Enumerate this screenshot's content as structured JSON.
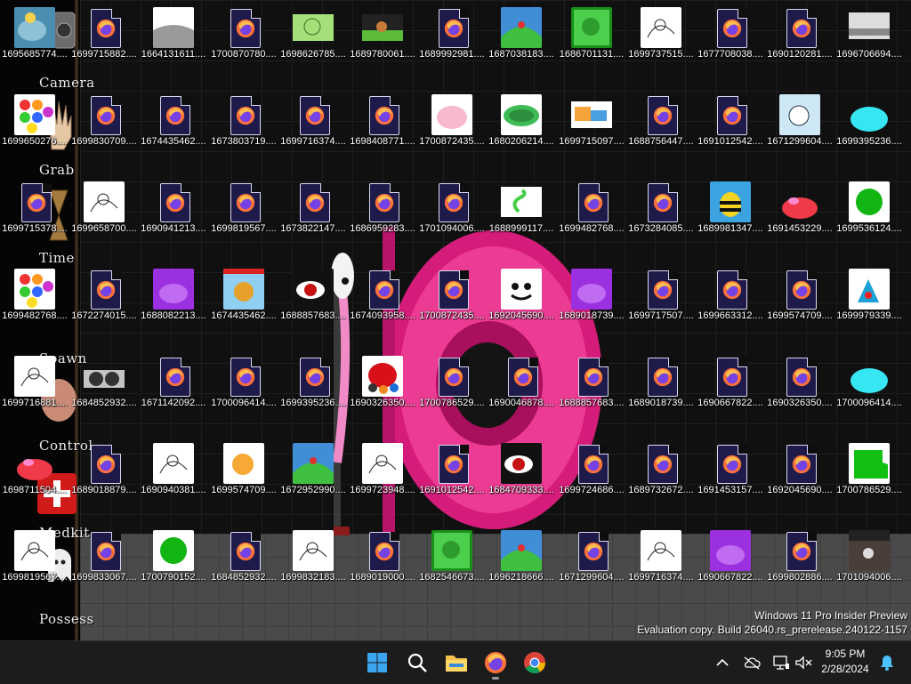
{
  "wallpaper": {
    "labels": [
      "Camera",
      "Grab",
      "Time",
      "Spawn",
      "Control",
      "Medkit",
      "Possess"
    ]
  },
  "icons": [
    {
      "label": "1695685774....",
      "kind": "game"
    },
    {
      "label": "1699715882....",
      "kind": "firefox"
    },
    {
      "label": "1664131611....",
      "kind": "gray"
    },
    {
      "label": "1700870780....",
      "kind": "firefox"
    },
    {
      "label": "1698626785....",
      "kind": "green-face"
    },
    {
      "label": "1689780061....",
      "kind": "scene"
    },
    {
      "label": "1689992981....",
      "kind": "firefox"
    },
    {
      "label": "1687038183....",
      "kind": "hill"
    },
    {
      "label": "1686701131....",
      "kind": "frog"
    },
    {
      "label": "1699737515....",
      "kind": "sketch"
    },
    {
      "label": "1677708038....",
      "kind": "firefox"
    },
    {
      "label": "1690120281....",
      "kind": "firefox"
    },
    {
      "label": "1696706694....",
      "kind": "road"
    },
    {
      "label": "1699650276....",
      "kind": "dots"
    },
    {
      "label": "1699830709....",
      "kind": "firefox"
    },
    {
      "label": "1674435462....",
      "kind": "firefox"
    },
    {
      "label": "1673803719....",
      "kind": "firefox"
    },
    {
      "label": "1699716374....",
      "kind": "firefox"
    },
    {
      "label": "1698408771....",
      "kind": "firefox"
    },
    {
      "label": "1700872435....",
      "kind": "pink-blob"
    },
    {
      "label": "1680206214....",
      "kind": "caterpillar"
    },
    {
      "label": "1699715097....",
      "kind": "orange-blue"
    },
    {
      "label": "1688756447....",
      "kind": "firefox"
    },
    {
      "label": "1691012542....",
      "kind": "firefox"
    },
    {
      "label": "1671299604....",
      "kind": "cat"
    },
    {
      "label": "1699395236....",
      "kind": "cyan-blob"
    },
    {
      "label": "1699715378....",
      "kind": "firefox"
    },
    {
      "label": "1699658700....",
      "kind": "sketch"
    },
    {
      "label": "1690941213....",
      "kind": "firefox"
    },
    {
      "label": "1699819567....",
      "kind": "firefox"
    },
    {
      "label": "1673822147....",
      "kind": "firefox"
    },
    {
      "label": "1686959283....",
      "kind": "firefox"
    },
    {
      "label": "1701094006....",
      "kind": "firefox"
    },
    {
      "label": "1688999117....",
      "kind": "snake"
    },
    {
      "label": "1699482768....",
      "kind": "firefox"
    },
    {
      "label": "1673284085....",
      "kind": "firefox"
    },
    {
      "label": "1689981347....",
      "kind": "bee"
    },
    {
      "label": "1691453229....",
      "kind": "red-blob"
    },
    {
      "label": "1699536124....",
      "kind": "green-circle"
    },
    {
      "label": "1699482768....",
      "kind": "dots"
    },
    {
      "label": "1672274015....",
      "kind": "firefox"
    },
    {
      "label": "1688082213....",
      "kind": "purple"
    },
    {
      "label": "1674435462....",
      "kind": "pineapple"
    },
    {
      "label": "1688857683....",
      "kind": "dark-red"
    },
    {
      "label": "1674093958....",
      "kind": "firefox"
    },
    {
      "label": "1700872435....",
      "kind": "firefox"
    },
    {
      "label": "1692045690....",
      "kind": "face"
    },
    {
      "label": "1689018739....",
      "kind": "purple"
    },
    {
      "label": "1699717507....",
      "kind": "firefox"
    },
    {
      "label": "1699663312....",
      "kind": "firefox"
    },
    {
      "label": "1699574709....",
      "kind": "firefox"
    },
    {
      "label": "1699979339....",
      "kind": "flag"
    },
    {
      "label": "1699716881....",
      "kind": "sketch"
    },
    {
      "label": "1684852932....",
      "kind": "dark-dots"
    },
    {
      "label": "1671142092....",
      "kind": "firefox"
    },
    {
      "label": "1700096414....",
      "kind": "firefox"
    },
    {
      "label": "1699395236....",
      "kind": "firefox"
    },
    {
      "label": "1690326350....",
      "kind": "red-bird"
    },
    {
      "label": "1700786529....",
      "kind": "firefox"
    },
    {
      "label": "1690046878....",
      "kind": "firefox"
    },
    {
      "label": "1688857683....",
      "kind": "firefox"
    },
    {
      "label": "1689018739....",
      "kind": "firefox"
    },
    {
      "label": "1690667822....",
      "kind": "firefox"
    },
    {
      "label": "1690326350....",
      "kind": "firefox"
    },
    {
      "label": "1700096414....",
      "kind": "cyan-blob"
    },
    {
      "label": "1698711504....",
      "kind": "red-blob"
    },
    {
      "label": "1689018879....",
      "kind": "firefox"
    },
    {
      "label": "1690940381....",
      "kind": "sketch"
    },
    {
      "label": "1699574709....",
      "kind": "orange-ball"
    },
    {
      "label": "1672952990....",
      "kind": "hill"
    },
    {
      "label": "1699723948....",
      "kind": "sketch"
    },
    {
      "label": "1691012542....",
      "kind": "firefox"
    },
    {
      "label": "1684709333....",
      "kind": "dark-red"
    },
    {
      "label": "1699724686....",
      "kind": "firefox"
    },
    {
      "label": "1689732672....",
      "kind": "firefox"
    },
    {
      "label": "1691453157....",
      "kind": "firefox"
    },
    {
      "label": "1692045690....",
      "kind": "firefox"
    },
    {
      "label": "1700786529....",
      "kind": "green-blob"
    },
    {
      "label": "1699819567....",
      "kind": "sketch"
    },
    {
      "label": "1699833067....",
      "kind": "firefox"
    },
    {
      "label": "1700790152....",
      "kind": "green-circle"
    },
    {
      "label": "1684852932....",
      "kind": "firefox"
    },
    {
      "label": "1699832183....",
      "kind": "sketch"
    },
    {
      "label": "1689019000....",
      "kind": "firefox"
    },
    {
      "label": "1682546673....",
      "kind": "frog"
    },
    {
      "label": "1696218666....",
      "kind": "hill"
    },
    {
      "label": "1671299604....",
      "kind": "firefox"
    },
    {
      "label": "1699716374....",
      "kind": "sketch"
    },
    {
      "label": "1690667822....",
      "kind": "purple"
    },
    {
      "label": "1699802886....",
      "kind": "firefox"
    },
    {
      "label": "1701094006....",
      "kind": "dark-photo"
    }
  ],
  "watermark": {
    "line1": "Windows 11 Pro Insider Preview",
    "line2": "Evaluation copy. Build 26040.rs_prerelease.240122-1157"
  },
  "taskbar": {
    "apps": [
      {
        "name": "start-button",
        "icon": "windows-logo-icon"
      },
      {
        "name": "search-button",
        "icon": "search-icon"
      },
      {
        "name": "file-explorer-button",
        "icon": "folder-icon"
      },
      {
        "name": "firefox-button",
        "icon": "firefox-icon"
      },
      {
        "name": "chrome-button",
        "icon": "chrome-icon"
      }
    ],
    "tray": [
      "chevron-up-icon",
      "cloud-offline-icon",
      "network-icon",
      "volume-muted-icon"
    ],
    "time": "9:05 PM",
    "date": "2/28/2024",
    "notification_icon": "bell-icon"
  },
  "colors": {
    "taskbar_bg": "#1c1c1c",
    "accent_blue": "#0078d4",
    "firefox_orange": "#ff7139",
    "firefox_purple": "#7542e5"
  }
}
